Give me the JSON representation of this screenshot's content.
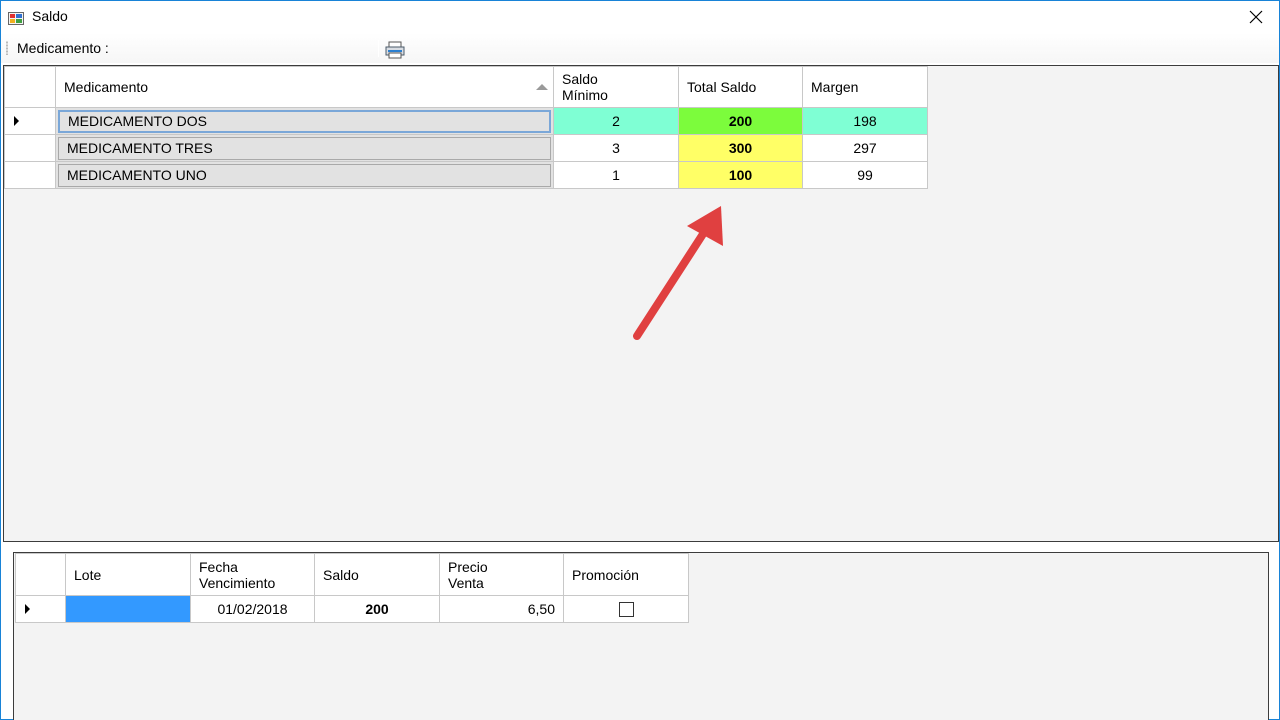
{
  "window": {
    "title": "Saldo",
    "close_glyph": "✕"
  },
  "toolbar": {
    "label": "Medicamento :",
    "print_icon": "printer-icon"
  },
  "grid_top": {
    "headers": {
      "medicamento": "Medicamento",
      "saldo_minimo_line1": "Saldo",
      "saldo_minimo_line2": "Mínimo",
      "total_saldo": "Total Saldo",
      "margen": "Margen"
    },
    "rows": [
      {
        "medicamento": "MEDICAMENTO DOS",
        "saldo_minimo": "2",
        "total_saldo": "200",
        "margen": "198"
      },
      {
        "medicamento": "MEDICAMENTO TRES",
        "saldo_minimo": "3",
        "total_saldo": "300",
        "margen": "297"
      },
      {
        "medicamento": "MEDICAMENTO UNO",
        "saldo_minimo": "1",
        "total_saldo": "100",
        "margen": "99"
      }
    ]
  },
  "grid_bottom": {
    "headers": {
      "lote": "Lote",
      "fecha_line1": "Fecha",
      "fecha_line2": "Vencimiento",
      "saldo": "Saldo",
      "precio_line1": "Precio",
      "precio_line2": "Venta",
      "promocion": "Promoción"
    },
    "rows": [
      {
        "lote": "",
        "fecha": "01/02/2018",
        "saldo": "200",
        "precio": "6,50",
        "promocion": false
      }
    ]
  },
  "colors": {
    "highlight_cyan": "#7fffd4",
    "highlight_green": "#7cfc3c",
    "highlight_yellow": "#ffff66",
    "selection_blue": "#3399ff",
    "annotation_arrow": "#e04040"
  }
}
